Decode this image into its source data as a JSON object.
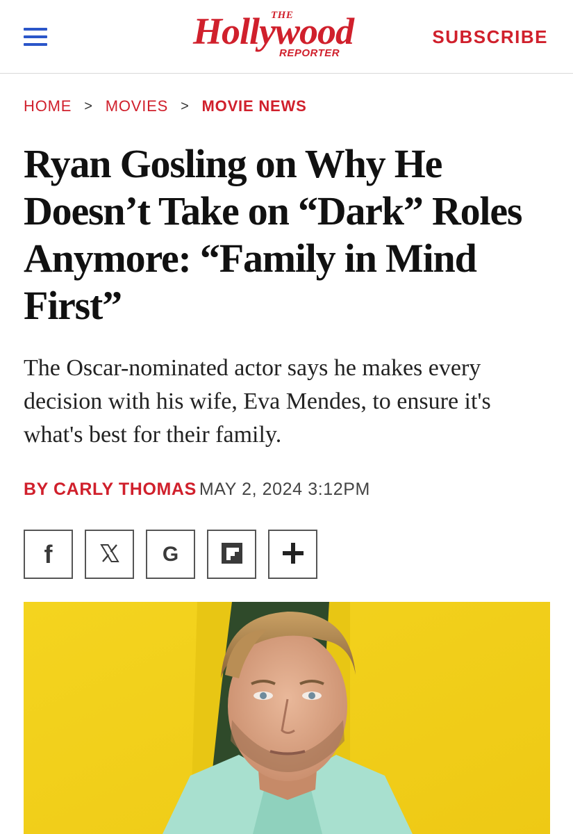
{
  "header": {
    "logo_the": "THE",
    "logo_main": "Hollywood",
    "logo_reporter": "REPORTER",
    "subscribe_label": "SUBSCRIBE",
    "brand_color": "#d0202c",
    "menu_icon": "hamburger-menu-icon"
  },
  "breadcrumb": [
    {
      "label": "HOME"
    },
    {
      "label": "MOVIES"
    },
    {
      "label": "MOVIE NEWS"
    }
  ],
  "breadcrumb_separator": ">",
  "article": {
    "headline": "Ryan Gosling on Why He Doesn’t Take on “Dark” Roles Anymore: “Family in Mind First”",
    "dek": "The Oscar-nominated actor says he makes every decision with his wife, Eva Mendes, to ensure it's what's best for their family.",
    "byline": "BY CARLY THOMAS",
    "date": "MAY 2, 2024 3:12PM"
  },
  "share": [
    {
      "icon": "facebook-icon",
      "glyph": "f"
    },
    {
      "icon": "x-icon",
      "glyph": "𝕏"
    },
    {
      "icon": "google-icon",
      "glyph": "G"
    },
    {
      "icon": "flipboard-icon",
      "glyph": ""
    },
    {
      "icon": "plus-icon",
      "glyph": "+"
    }
  ],
  "hero_image": {
    "background_color": "#f2d11b",
    "jacket_color": "#a8e0cf"
  }
}
